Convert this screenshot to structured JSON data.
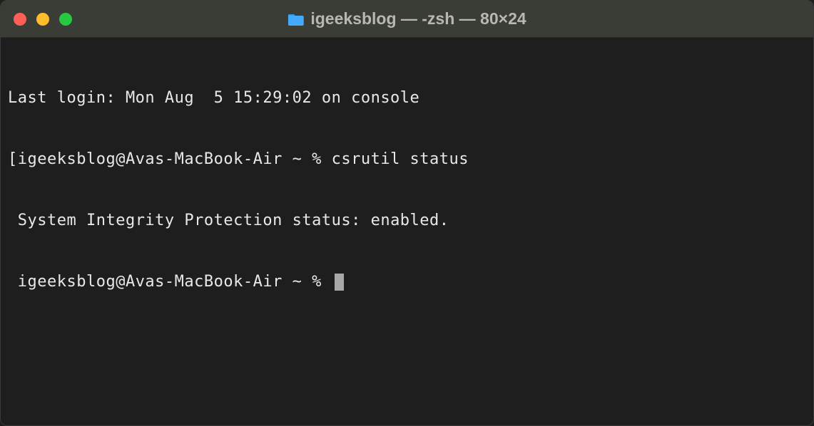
{
  "window": {
    "title": "igeeksblog — -zsh — 80×24"
  },
  "terminal": {
    "lines": {
      "last_login": "Last login: Mon Aug  5 15:29:02 on console",
      "prompt1_bracket": "[",
      "prompt1_text": "igeeksblog@Avas-MacBook-Air ~ % ",
      "command1": "csrutil status",
      "output1": "System Integrity Protection status: enabled.",
      "prompt2_text": "igeeksblog@Avas-MacBook-Air ~ % "
    }
  }
}
